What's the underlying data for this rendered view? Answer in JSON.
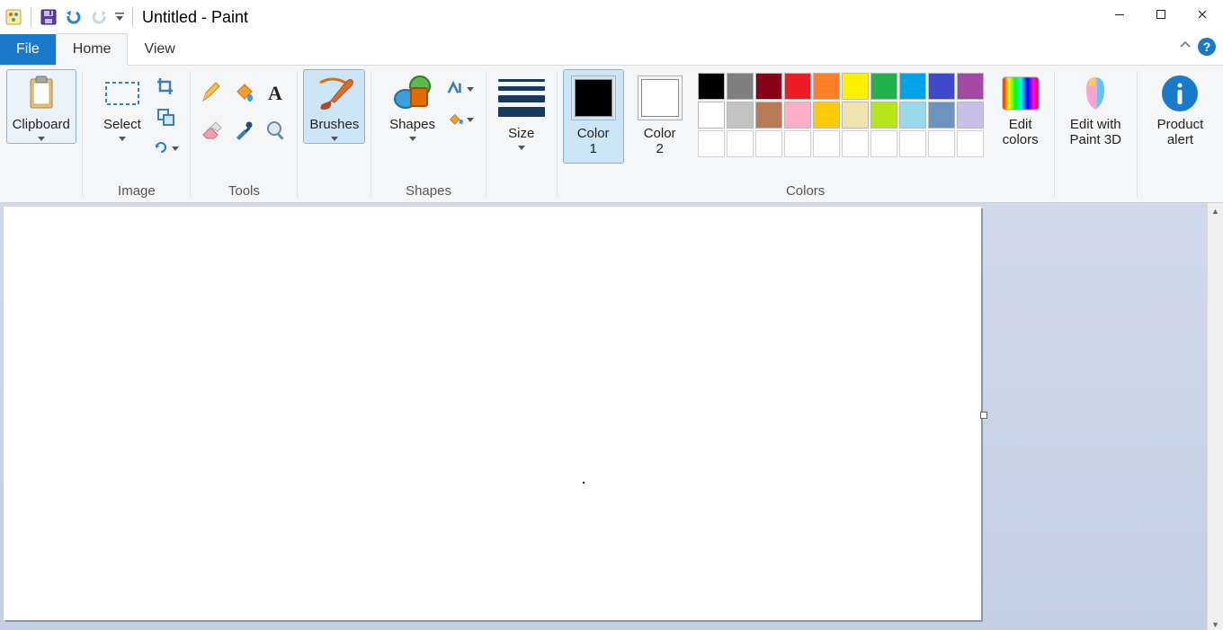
{
  "title": "Untitled - Paint",
  "tabs": {
    "file": "File",
    "home": "Home",
    "view": "View"
  },
  "ribbon_groups": {
    "clipboard": "Clipboard",
    "select": "Select",
    "image": "Image",
    "tools": "Tools",
    "brushes": "Brushes",
    "shapes": "Shapes",
    "size": "Size",
    "color1": "Color 1",
    "color2": "Color 2",
    "colors_group": "Colors",
    "edit_colors": "Edit colors",
    "paint3d": "Edit with Paint 3D",
    "product_alert": "Product alert"
  },
  "palette": {
    "row1": [
      "#000000",
      "#7f7f7f",
      "#880015",
      "#ed1c24",
      "#ff7f27",
      "#fff200",
      "#22b14c",
      "#00a2e8",
      "#3f48cc",
      "#a349a4"
    ],
    "row2": [
      "#ffffff",
      "#c3c3c3",
      "#b97a57",
      "#ffaec9",
      "#ffc90e",
      "#efe4b0",
      "#b5e61d",
      "#99d9ea",
      "#7092be",
      "#c8bfe7"
    ]
  },
  "active_color1": "#000000",
  "active_color2": "#ffffff"
}
